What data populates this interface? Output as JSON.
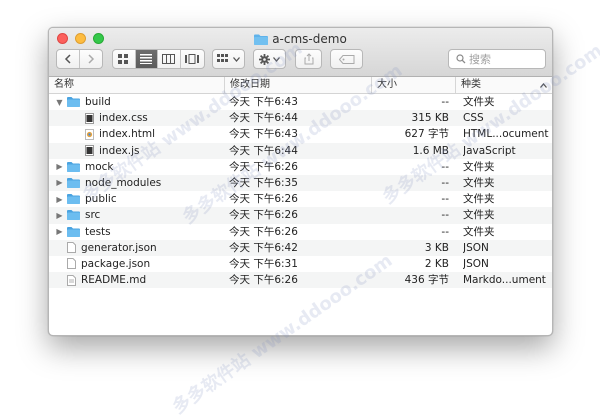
{
  "window": {
    "title": "a-cms-demo",
    "search_placeholder": "搜索"
  },
  "columns": [
    "名称",
    "修改日期",
    "大小",
    "种类"
  ],
  "rows": [
    {
      "name": "build",
      "date": "今天 下午6:43",
      "size": "--",
      "kind": "文件夹",
      "type": "folder",
      "indent": 0,
      "expanded": true
    },
    {
      "name": "index.css",
      "date": "今天 下午6:44",
      "size": "315 KB",
      "kind": "CSS",
      "type": "css",
      "indent": 1
    },
    {
      "name": "index.html",
      "date": "今天 下午6:43",
      "size": "627 字节",
      "kind": "HTML...ocument",
      "type": "html",
      "indent": 1
    },
    {
      "name": "index.js",
      "date": "今天 下午6:44",
      "size": "1.6 MB",
      "kind": "JavaScript",
      "type": "js",
      "indent": 1
    },
    {
      "name": "mock",
      "date": "今天 下午6:26",
      "size": "--",
      "kind": "文件夹",
      "type": "folder",
      "indent": 0,
      "expanded": false
    },
    {
      "name": "node_modules",
      "date": "今天 下午6:35",
      "size": "--",
      "kind": "文件夹",
      "type": "folder",
      "indent": 0,
      "expanded": false
    },
    {
      "name": "public",
      "date": "今天 下午6:26",
      "size": "--",
      "kind": "文件夹",
      "type": "folder",
      "indent": 0,
      "expanded": false
    },
    {
      "name": "src",
      "date": "今天 下午6:26",
      "size": "--",
      "kind": "文件夹",
      "type": "folder",
      "indent": 0,
      "expanded": false
    },
    {
      "name": "tests",
      "date": "今天 下午6:26",
      "size": "--",
      "kind": "文件夹",
      "type": "folder",
      "indent": 0,
      "expanded": false
    },
    {
      "name": "generator.json",
      "date": "今天 下午6:42",
      "size": "3 KB",
      "kind": "JSON",
      "type": "doc",
      "indent": 0
    },
    {
      "name": "package.json",
      "date": "今天 下午6:31",
      "size": "2 KB",
      "kind": "JSON",
      "type": "doc",
      "indent": 0
    },
    {
      "name": "README.md",
      "date": "今天 下午6:26",
      "size": "436 字节",
      "kind": "Markdo...ument",
      "type": "md",
      "indent": 0
    }
  ],
  "watermark": "多多软件站 www.ddooo.com",
  "colors": {
    "folder": "#5fb2ea",
    "accent_close": "#fc605c",
    "accent_min": "#fdbc40",
    "accent_max": "#34c84a"
  }
}
